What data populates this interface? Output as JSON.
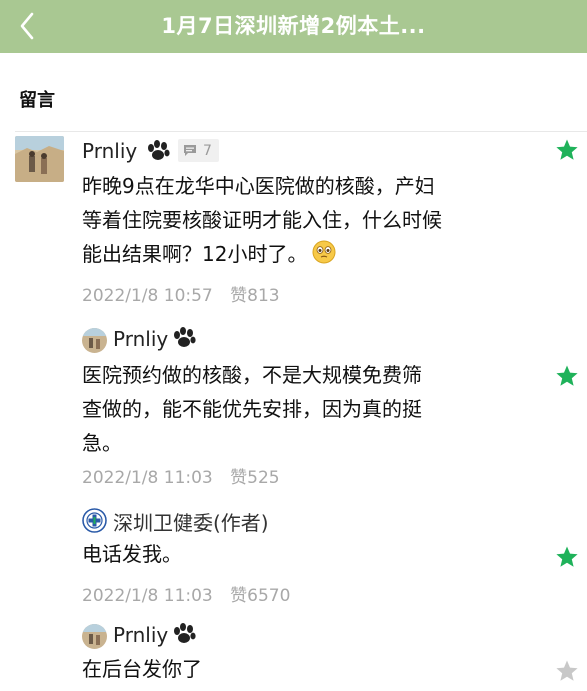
{
  "header": {
    "title": "1月7日深圳新增2例本土..."
  },
  "section": {
    "title": "留言"
  },
  "comment": {
    "author": "Prnliy",
    "reply_count": "7",
    "text_lines": [
      "昨晚9点在龙华中心医院做的核酸，产妇",
      "等着住院要核酸证明才能入住，什么时候",
      "能出结果啊？12小时了。"
    ],
    "time": "2022/1/8 10:57",
    "likes": "赞813"
  },
  "replies": [
    {
      "author": "Prnliy",
      "text_lines": [
        "医院预约做的核酸，不是大规模免费筛",
        "查做的，能不能优先安排，因为真的挺",
        "急。"
      ],
      "time": "2022/1/8 11:03",
      "likes": "赞525"
    },
    {
      "author": "深圳卫健委(作者)",
      "text_lines": [
        "电话发我。"
      ],
      "time": "2022/1/8 11:03",
      "likes": "赞6570"
    },
    {
      "author": "Prnliy",
      "text_lines": [
        "在后台发你了"
      ]
    }
  ],
  "colors": {
    "header_bg": "#a9c892",
    "star_active": "#1fb25a",
    "star_inactive": "#c8c8c8",
    "meta": "#a8a8a8"
  },
  "icons": [
    "back-chevron",
    "paw",
    "comment-bubble",
    "star",
    "emoji-smile"
  ]
}
